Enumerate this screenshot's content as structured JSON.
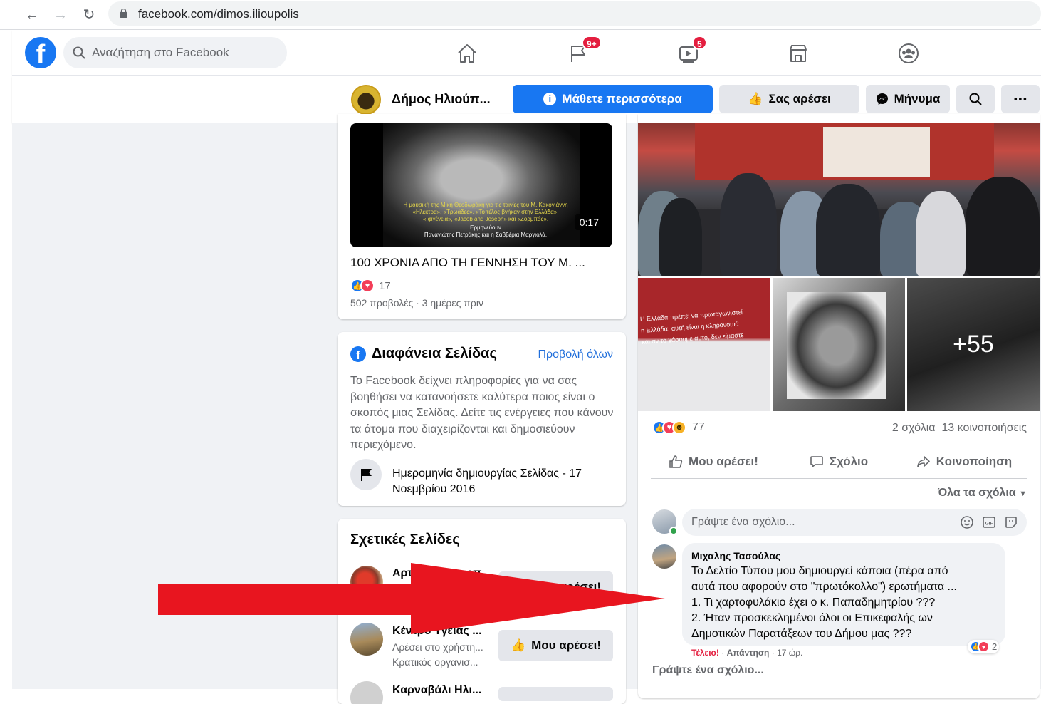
{
  "browser": {
    "url": "facebook.com/dimos.ilioupolis",
    "back_icon": "arrow-left-icon",
    "forward_icon": "arrow-right-icon",
    "reload_icon": "reload-icon"
  },
  "fb_header": {
    "logo": "f",
    "search_placeholder": "Αναζήτηση στο Facebook",
    "tabs": [
      {
        "icon": "home-icon",
        "badge": ""
      },
      {
        "icon": "flag-icon",
        "badge": "9+"
      },
      {
        "icon": "watch-icon",
        "badge": "5"
      },
      {
        "icon": "marketplace-icon",
        "badge": ""
      },
      {
        "icon": "groups-icon",
        "badge": ""
      }
    ]
  },
  "page_bar": {
    "name": "Δήμος Ηλιούπ...",
    "learn_more": "Μάθετε περισσότερα",
    "like": "Σας αρέσει",
    "message": "Μήνυμα"
  },
  "video": {
    "caption_yellow": "Η μουσική της Μίκη Θεοδωράκη για τις ταινίες του Μ. Κακογιάννη «Ηλέκτρα», «Τρωάδες», «Το τέλος βγήκαν στην Ελλάδα», «Ιφιγένεια», «Jacob and Joseph» και «Ζορμπάς».",
    "caption_white_1": "Ερμηνεύουν",
    "caption_white_2": "Παναγιώτης Πετράκης και η Σαββέρια Μαργιολά.",
    "duration": "0:17",
    "title": "100 ΧΡΟΝΙΑ ΑΠΟ ΤΗ ΓΕΝΝΗΣΗ ΤΟΥ Μ. ...",
    "reactions": "17",
    "meta": "502 προβολές · 3 ημέρες πριν"
  },
  "transparency": {
    "title": "Διαφάνεια Σελίδας",
    "see_all": "Προβολή όλων",
    "description": "Το Facebook δείχνει πληροφορίες για να σας βοηθήσει να κατανοήσετε καλύτερα ποιος είναι ο σκοπός μιας Σελίδας. Δείτε τις ενέργειες που κάνουν τα άτομα που διαχειρίζονται και δημοσιεύουν περιεχόμενο.",
    "created": "Ημερομηνία δημιουργίας Σελίδας - 17 Νοεμβρίου 2016"
  },
  "related": {
    "title": "Σχετικές Σελίδες",
    "pages": [
      {
        "name": "Αρτ... ...ζαχαροπ...",
        "sub1": "",
        "sub2": "",
        "button": "Μου αρέσει!"
      },
      {
        "name": "Κέντρο Υγείας ...",
        "sub1": "Αρέσει στο χρήστη...",
        "sub2": "Κρατικός οργανισ...",
        "button": "Μου αρέσει!"
      },
      {
        "name": "Καρναβάλι Ηλι...",
        "sub1": "",
        "sub2": "",
        "button": ""
      }
    ]
  },
  "post": {
    "plus_count": "+55",
    "reactions": "77",
    "comments": "2 σχόλια",
    "shares": "13 κοινοποιήσεις",
    "actions": {
      "like": "Μου αρέσει!",
      "comment": "Σχόλιο",
      "share": "Κοινοποίηση"
    },
    "all_comments": "Όλα τα σχόλια",
    "comment_placeholder": "Γράψτε ένα σχόλιο...",
    "comment": {
      "author": "Μιχαλης Τασούλας",
      "lines": [
        "Το Δελτίο Τύπου μου δημιουργεί κάποια (πέρα από",
        "αυτά που αφορούν στο \"πρωτόκολλο\") ερωτήματα ...",
        "1. Τι χαρτοφυλάκιο έχει ο κ. Παπαδημητρίου ???",
        "2. Ήταν προσκεκλημένοι όλοι οι Επικεφαλής ων",
        "Δημοτικών Παρατάξεων του Δήμου μας ???"
      ],
      "reaction_count": "2",
      "reaction_label": "Τέλειο!",
      "reply": "Απάντηση",
      "time": "17 ώρ."
    },
    "write_comment": "Γράψτε ένα σχόλιο..."
  },
  "colors": {
    "fb_blue": "#1877f2",
    "annotation_arrow": "#e8151f"
  }
}
